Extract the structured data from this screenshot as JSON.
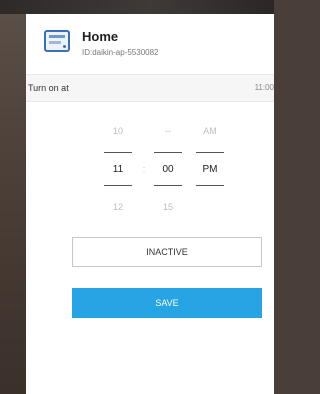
{
  "header": {
    "title": "Home",
    "device_id": "ID:daikin-ap-5530082",
    "icon": "ac-unit-icon"
  },
  "turn_on": {
    "label": "Turn on at",
    "value": "11:00"
  },
  "time_picker": {
    "prev": {
      "hour": "10",
      "minute": "--",
      "period": "AM"
    },
    "selected": {
      "hour": "11",
      "separator": ":",
      "minute": "00",
      "period": "PM"
    },
    "next": {
      "hour": "12",
      "minute": "15"
    }
  },
  "buttons": {
    "inactive_label": "INACTIVE",
    "save_label": "SAVE"
  },
  "colors": {
    "accent": "#27a4e3",
    "icon_blue": "#3c6fb6"
  }
}
